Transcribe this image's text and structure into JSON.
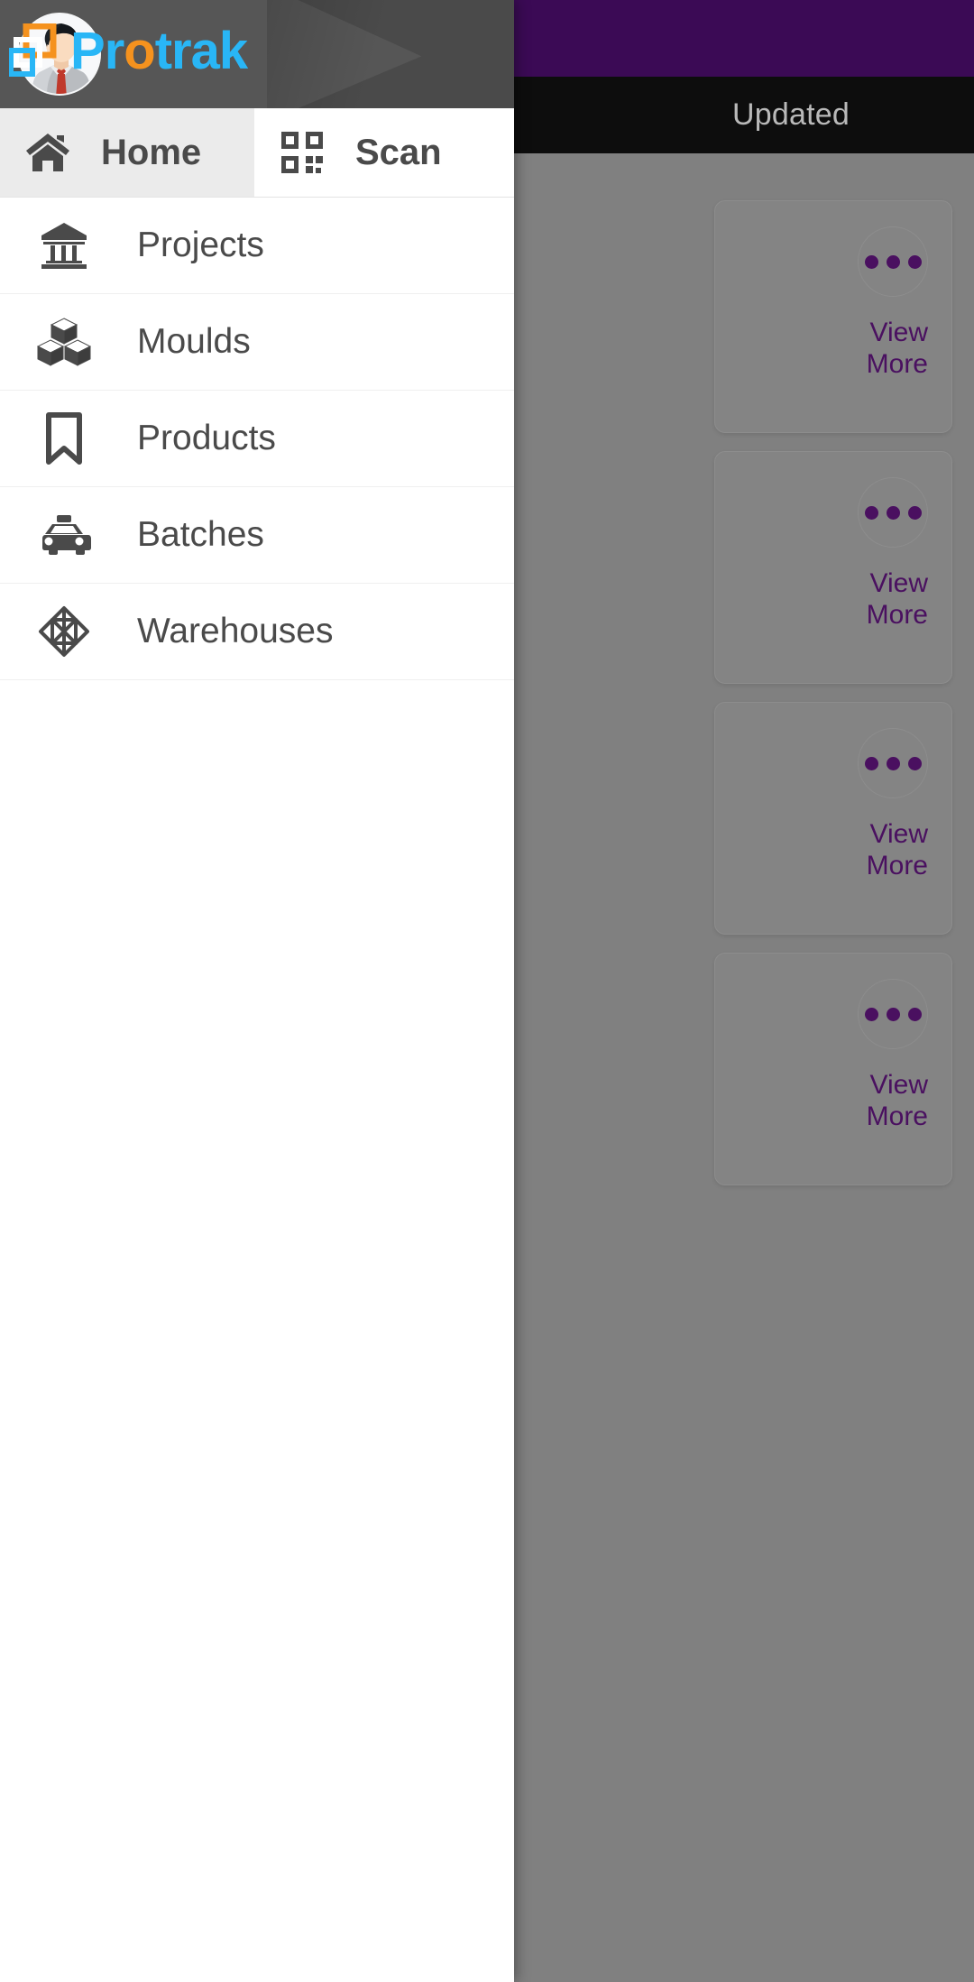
{
  "background": {
    "status_bar_color": "#3b0a55",
    "app_bar": {
      "background": "#0d0d0d",
      "column_header": "Updated"
    },
    "content_background": "#808080",
    "accent_color": "#4a1060",
    "cards": [
      {
        "menu_icon": "kebab-icon",
        "view_more_label": "View\nMore"
      },
      {
        "menu_icon": "kebab-icon",
        "view_more_label": "View\nMore"
      },
      {
        "menu_icon": "kebab-icon",
        "view_more_label": "View\nMore"
      },
      {
        "menu_icon": "kebab-icon",
        "view_more_label": "View\nMore"
      }
    ]
  },
  "drawer": {
    "header": {
      "background": "#4a4a4a",
      "avatar_icon": "user-avatar",
      "brand": {
        "mark_icon": "overlapping-squares-logo",
        "part_1": "P",
        "part_2": "r",
        "part_3": "o",
        "part_4": "trak",
        "color_blue": "#29b6f6",
        "color_orange": "#f5921e"
      }
    },
    "tabs": [
      {
        "label": "Home",
        "icon": "home-icon",
        "selected": true
      },
      {
        "label": "Scan",
        "icon": "qr-code-icon",
        "selected": false
      }
    ],
    "items": [
      {
        "label": "Projects",
        "icon": "bank-building-icon"
      },
      {
        "label": "Moulds",
        "icon": "stacked-cubes-icon"
      },
      {
        "label": "Products",
        "icon": "bookmark-icon"
      },
      {
        "label": "Batches",
        "icon": "taxi-car-icon"
      },
      {
        "label": "Warehouses",
        "icon": "wireframe-box-icon"
      }
    ]
  }
}
